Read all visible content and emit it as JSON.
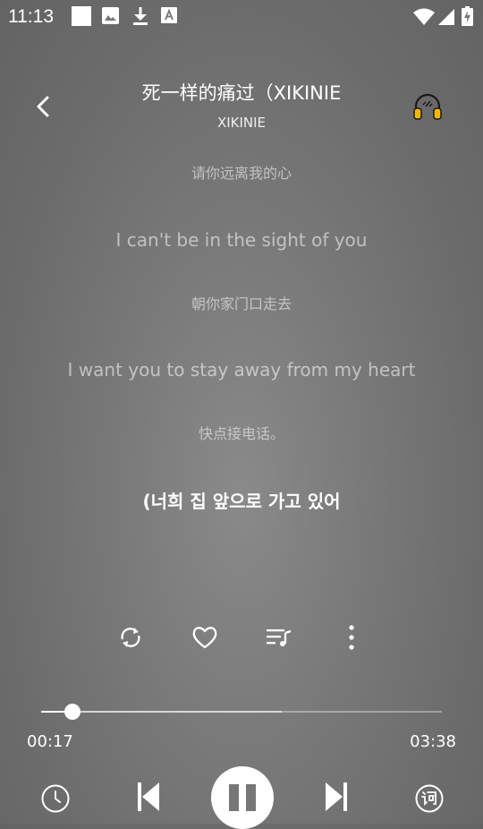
{
  "status_bar": {
    "time": "11:13",
    "icons": [
      "white-square-icon",
      "image-icon",
      "download-icon",
      "font-icon",
      "wifi-icon",
      "signal-icon",
      "battery-charging-icon"
    ]
  },
  "header": {
    "title": "死一样的痛过（XIKINIE",
    "artist": "XIKINIE",
    "back_icon": "chevron-left-icon",
    "headphone_icon": "headphone-effect-icon"
  },
  "lyrics": [
    {
      "text": "请你远离我的心",
      "state": "inactive"
    },
    {
      "text": "I can't be in the sight of you",
      "state": "inactive"
    },
    {
      "text": "朝你家门口走去",
      "state": "inactive"
    },
    {
      "text": "I want you to stay away from my heart",
      "state": "inactive"
    },
    {
      "text": "快点接电话。",
      "state": "inactive"
    },
    {
      "text": "(너희 집 앞으로 가고 있어",
      "state": "current"
    }
  ],
  "actions": [
    "repeat-icon",
    "heart-icon",
    "playlist-icon",
    "more-vertical-icon"
  ],
  "progress": {
    "current": "00:17",
    "total": "03:38",
    "played_fraction": 0.078,
    "buffered_fraction": 0.6
  },
  "controls": [
    "timer-icon",
    "previous-icon",
    "pause-icon",
    "next-icon",
    "lyrics-icon"
  ],
  "colors": {
    "accent": "#FFFFFF",
    "headphone": "#F2B705",
    "background": "#7A7A7A"
  }
}
